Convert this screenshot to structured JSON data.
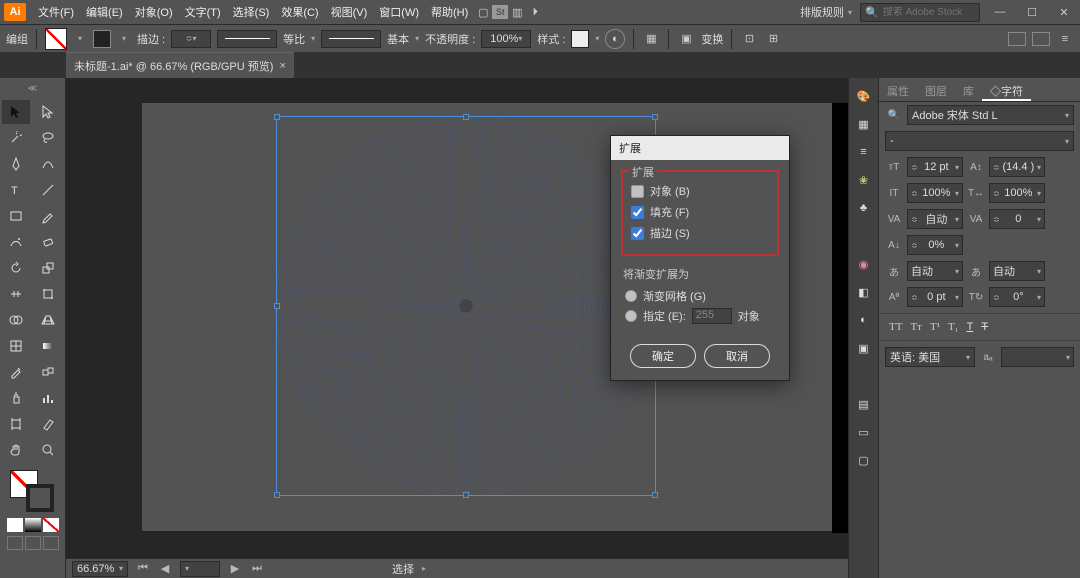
{
  "app": {
    "logo": "Ai"
  },
  "menus": [
    "文件(F)",
    "编辑(E)",
    "对象(O)",
    "文字(T)",
    "选择(S)",
    "效果(C)",
    "视图(V)",
    "窗口(W)",
    "帮助(H)"
  ],
  "title_right": {
    "rule_label": "排版规则",
    "search_placeholder": "搜索 Adobe Stock"
  },
  "optbar": {
    "group": "编组",
    "stroke_label": "描边 :",
    "stroke_val": "",
    "profile_label": "等比",
    "brush_label": "基本",
    "opacity_label": "不透明度 :",
    "opacity_val": "100%",
    "style_label": "样式 :",
    "transform": "变换"
  },
  "doc_tab": {
    "label": "未标题-1.ai* @ 66.67% (RGB/GPU 预览)"
  },
  "status": {
    "zoom": "66.67%",
    "sel": "选择"
  },
  "dialog": {
    "title": "扩展",
    "group_title": "扩展",
    "chk_object": "对象 (B)",
    "chk_fill": "填充 (F)",
    "chk_stroke": "描边 (S)",
    "sub_title": "将渐变扩展为",
    "radio_mesh": "渐变网格 (G)",
    "radio_spec": "指定 (E):",
    "spec_val": "255",
    "spec_unit": "对象",
    "ok": "确定",
    "cancel": "取消"
  },
  "panel": {
    "tabs": [
      "属性",
      "图层",
      "库",
      "字符"
    ],
    "font": "Adobe 宋体 Std L",
    "font_style": "-",
    "size": "12 pt",
    "leading": "(14.4 )",
    "vscale": "100%",
    "hscale": "100%",
    "kerning": "自动",
    "tracking": "0",
    "baseline": "0%",
    "skew": "自动",
    "tsume": "自动",
    "mojikumi": "自动",
    "shift": "0 pt",
    "rotate": "0°",
    "lang": "英语: 美国"
  }
}
